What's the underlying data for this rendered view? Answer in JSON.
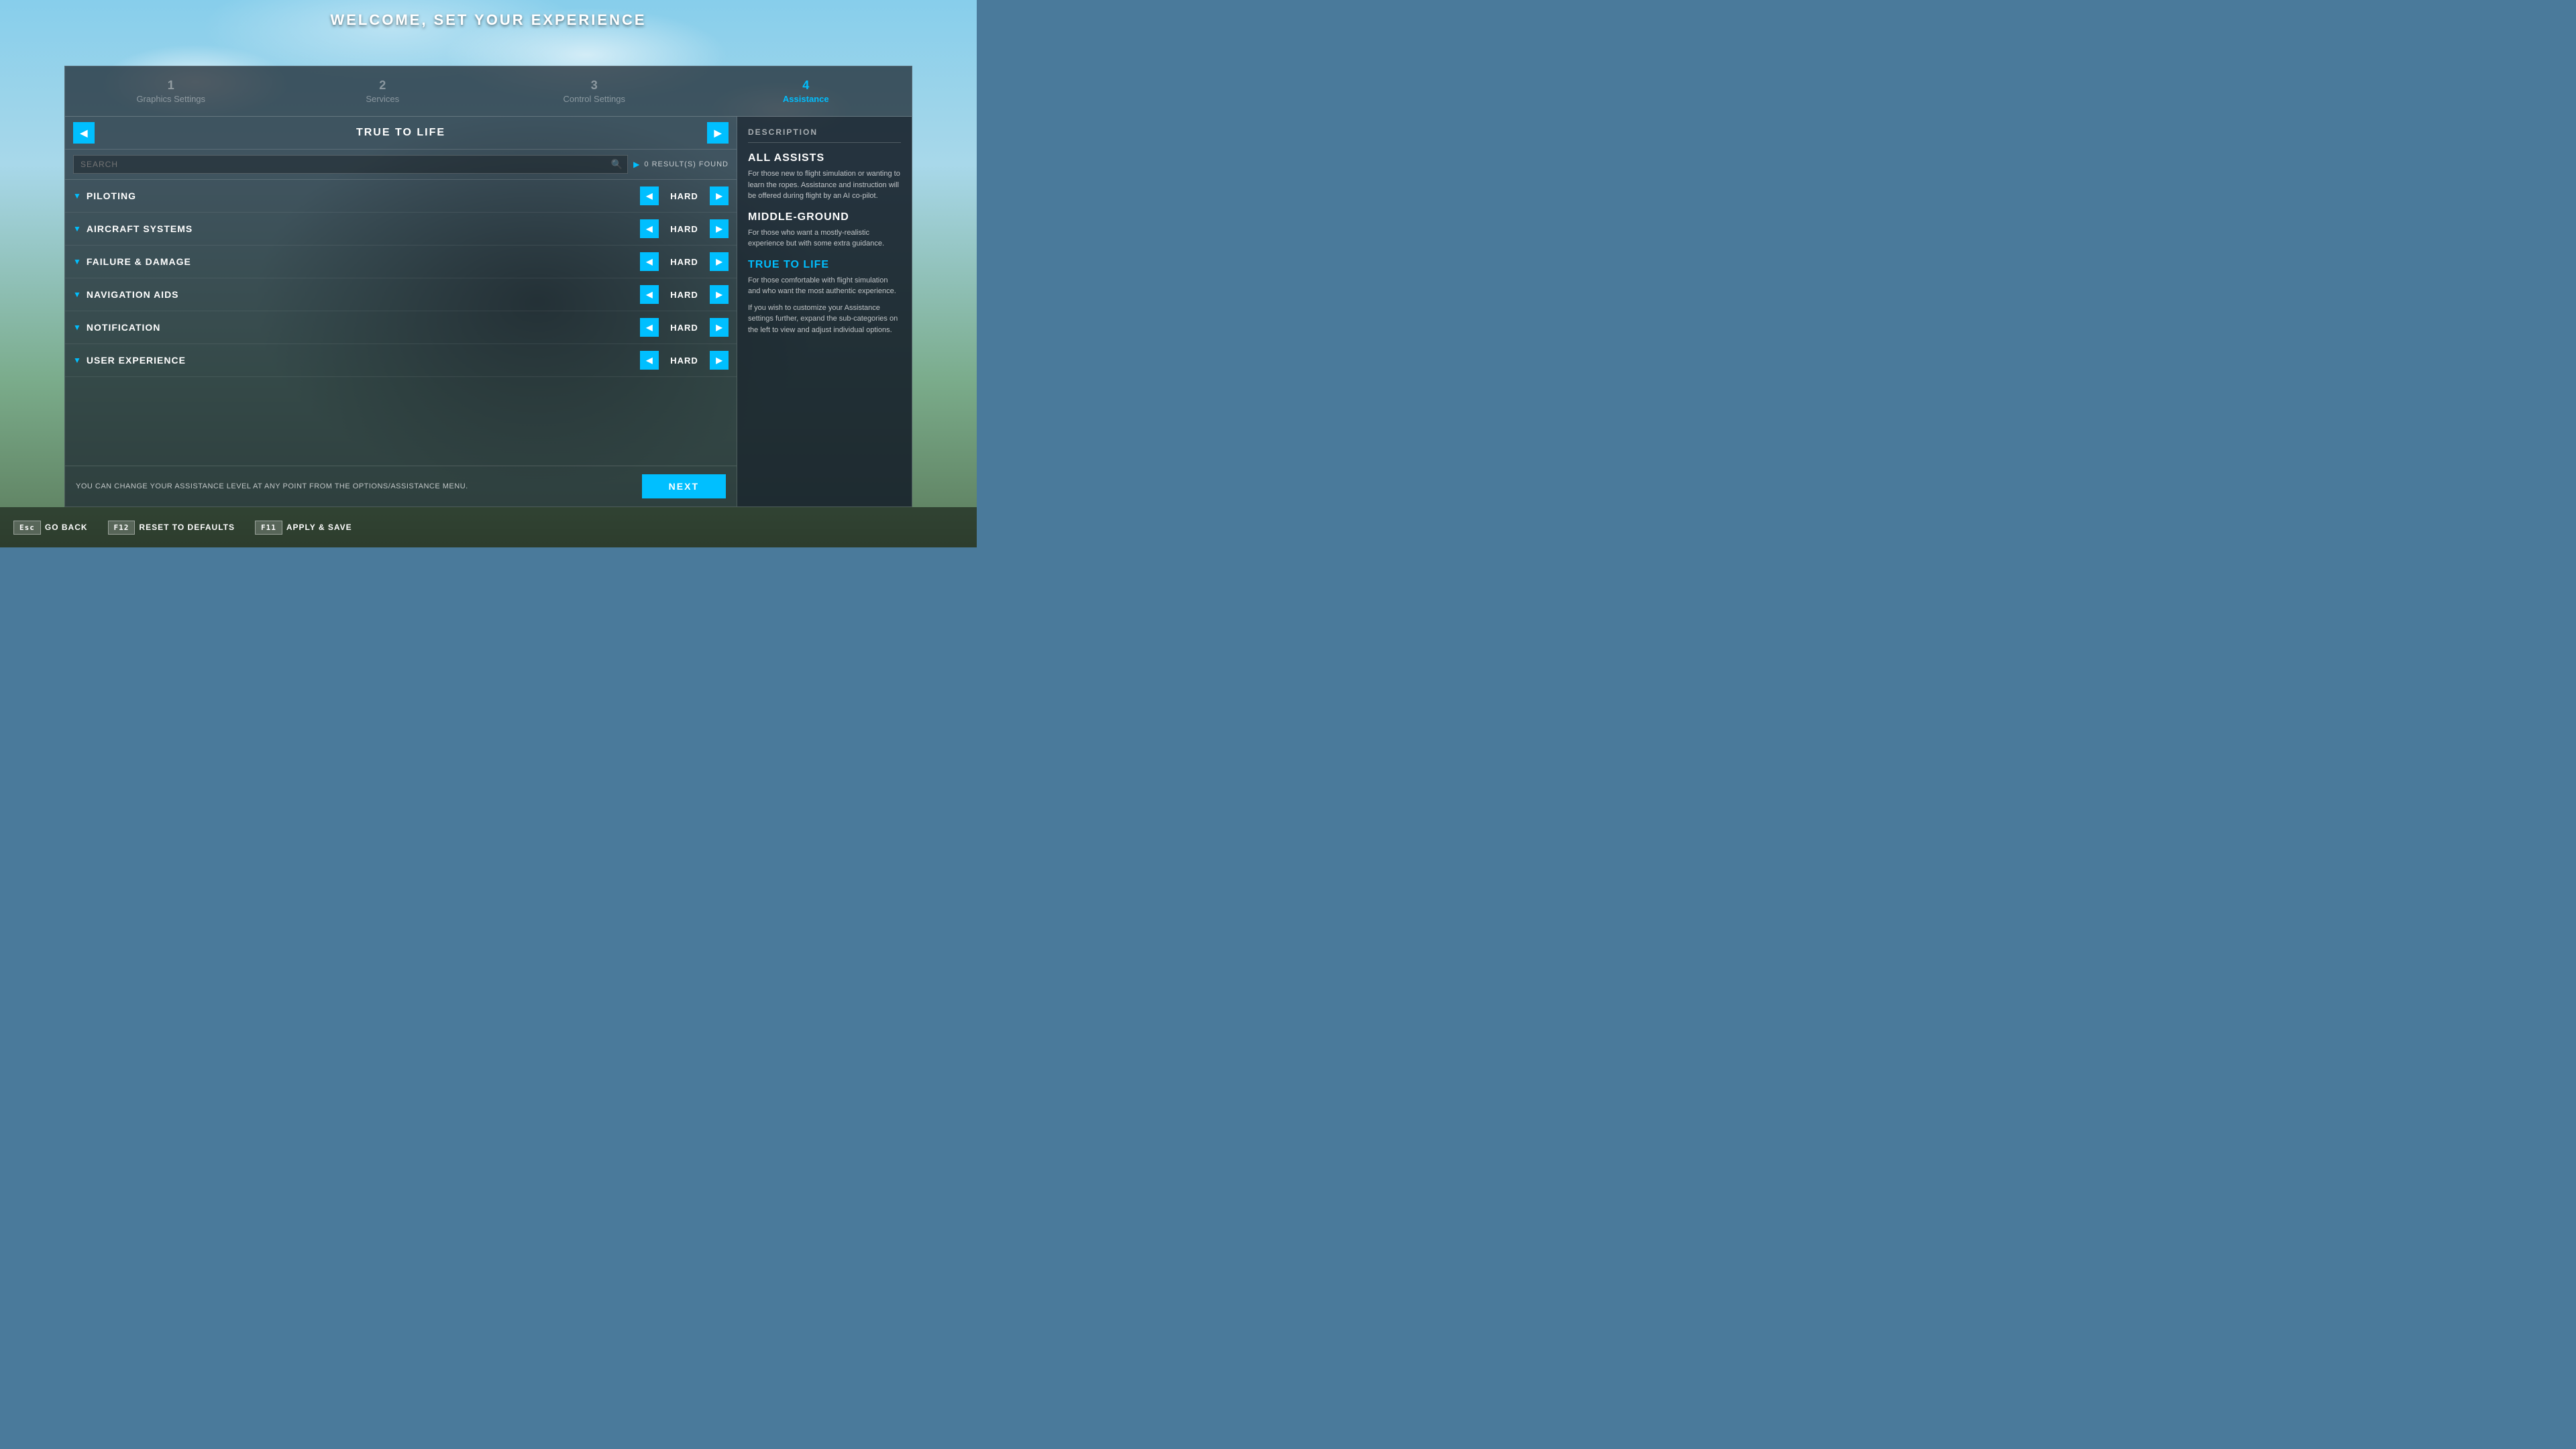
{
  "title": "WELCOME, SET YOUR EXPERIENCE",
  "steps": [
    {
      "num": "1",
      "label": "Graphics Settings",
      "active": false
    },
    {
      "num": "2",
      "label": "Services",
      "active": false
    },
    {
      "num": "3",
      "label": "Control Settings",
      "active": false
    },
    {
      "num": "4",
      "label": "Assistance",
      "active": true
    }
  ],
  "preset": {
    "left_arrow": "◀",
    "right_arrow": "▶",
    "title": "TRUE TO LIFE"
  },
  "search": {
    "placeholder": "SEARCH",
    "results_text": "0 RESULT(S) FOUND"
  },
  "categories": [
    {
      "name": "PILOTING",
      "value": "HARD"
    },
    {
      "name": "AIRCRAFT SYSTEMS",
      "value": "HARD"
    },
    {
      "name": "FAILURE & DAMAGE",
      "value": "HARD"
    },
    {
      "name": "NAVIGATION AIDS",
      "value": "HARD"
    },
    {
      "name": "NOTIFICATION",
      "value": "HARD"
    },
    {
      "name": "USER EXPERIENCE",
      "value": "HARD"
    }
  ],
  "description": {
    "title": "DESCRIPTION",
    "sections": [
      {
        "title": "ALL ASSISTS",
        "active": false,
        "text": "For those new to flight simulation or wanting to learn the ropes. Assistance and instruction will be offered during flight by an AI co-pilot."
      },
      {
        "title": "MIDDLE-GROUND",
        "active": false,
        "text": "For those who want a mostly-realistic experience but with some extra guidance."
      },
      {
        "title": "TRUE TO LIFE",
        "active": true,
        "text": "For those comfortable with flight simulation and who want the most authentic experience."
      }
    ],
    "extra_text": "If you wish to customize your Assistance settings further, expand the sub-categories on the left to view and adjust individual options."
  },
  "bottom_note": "YOU CAN CHANGE YOUR ASSISTANCE LEVEL AT ANY POINT FROM THE OPTIONS/ASSISTANCE MENU.",
  "next_label": "NEXT",
  "keyboard_shortcuts": [
    {
      "key": "Esc",
      "label": "GO BACK"
    },
    {
      "key": "F12",
      "label": "RESET TO DEFAULTS"
    },
    {
      "key": "F11",
      "label": "APPLY & SAVE"
    }
  ]
}
